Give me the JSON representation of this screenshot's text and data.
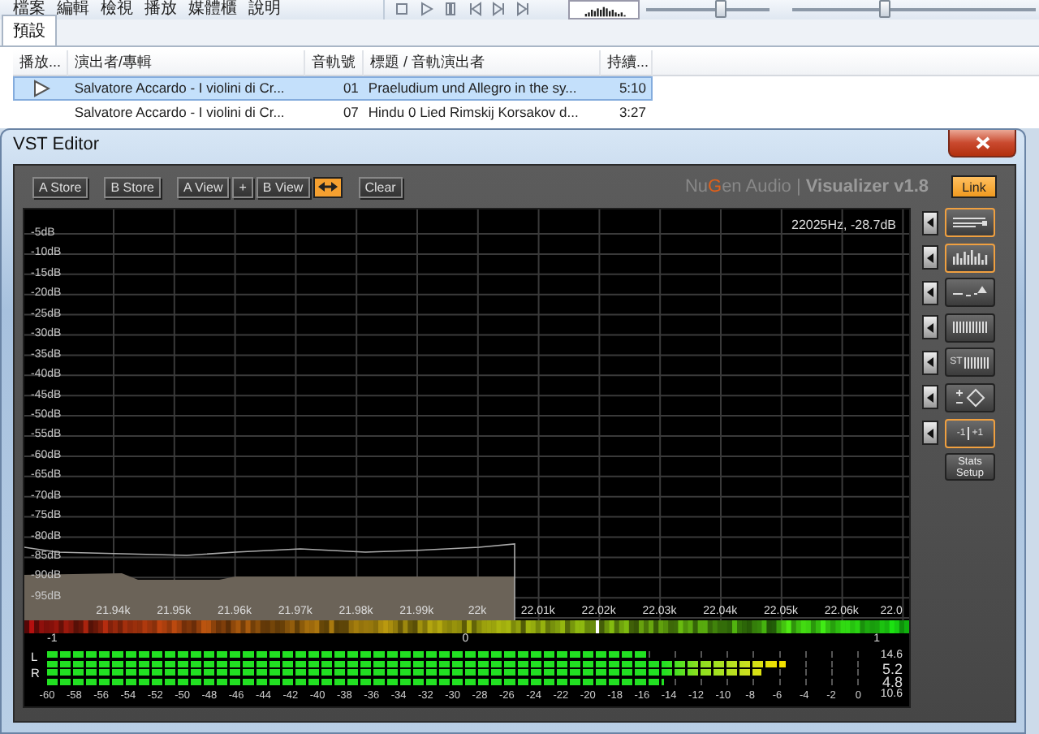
{
  "player": {
    "menu": [
      "檔案",
      "編輯",
      "檢視",
      "播放",
      "媒體櫃",
      "說明"
    ],
    "sliders": [
      {
        "level": 0.6
      },
      {
        "level": 0.38
      }
    ]
  },
  "tabs": [
    {
      "label": "預設",
      "selected": true
    }
  ],
  "playlist": {
    "columns": [
      "播放...",
      "演出者/專輯",
      "音軌號",
      "標題 / 音軌演出者",
      "持續..."
    ],
    "rows": [
      {
        "playing": true,
        "selected": true,
        "artist_album": "Salvatore Accardo - I violini di Cr...",
        "track": "01",
        "title": "Praeludium und Allegro in the sy...",
        "duration": "5:10"
      },
      {
        "playing": false,
        "selected": false,
        "artist_album": "Salvatore Accardo - I violini di Cr...",
        "track": "07",
        "title": "Hindu 0 Lied Rimskij Korsakov d...",
        "duration": "3:27"
      }
    ]
  },
  "editor": {
    "title": "VST Editor",
    "toolbar": [
      {
        "kind": "text",
        "label": "A Store"
      },
      {
        "kind": "gap"
      },
      {
        "kind": "text",
        "label": "B Store"
      },
      {
        "kind": "gap"
      },
      {
        "kind": "text",
        "label": "A View"
      },
      {
        "kind": "text",
        "label": "+"
      },
      {
        "kind": "text",
        "label": "B View"
      },
      {
        "kind": "swap",
        "on": true
      },
      {
        "kind": "gap"
      },
      {
        "kind": "text",
        "label": "Clear"
      }
    ],
    "brand": {
      "maker": [
        "Nu",
        "G",
        "en Audio"
      ],
      "separator": "|",
      "product": "Visualizer v1.8"
    },
    "link": {
      "label": "Link",
      "on": true
    },
    "spectrum": {
      "readout": "22025Hz, -28.7dB",
      "y_labels": [
        "-5dB",
        "-10dB",
        "-15dB",
        "-20dB",
        "-25dB",
        "-30dB",
        "-35dB",
        "-40dB",
        "-45dB",
        "-50dB",
        "-55dB",
        "-60dB",
        "-65dB",
        "-70dB",
        "-75dB",
        "-80dB",
        "-85dB",
        "-90dB",
        "-95dB"
      ],
      "x_labels": [
        "21.94k",
        "21.95k",
        "21.96k",
        "21.97k",
        "21.98k",
        "21.99k",
        "22k",
        "22.01k",
        "22.02k",
        "22.03k",
        "22.04k",
        "22.05k",
        "22.06k",
        "22.0"
      ]
    },
    "correlation": {
      "labels": [
        "-1",
        "0",
        "1"
      ]
    },
    "meters": {
      "channels": [
        "L",
        "R"
      ],
      "bars": [
        {
          "level": 0.74
        },
        {
          "level": 0.91
        },
        {
          "level": 0.88
        },
        {
          "level": 0.76
        }
      ],
      "readouts": [
        "14.6",
        "5.2",
        "4.8",
        "10.6"
      ],
      "scale": [
        "-60",
        "-58",
        "-56",
        "-54",
        "-52",
        "-50",
        "-48",
        "-46",
        "-44",
        "-42",
        "-40",
        "-38",
        "-36",
        "-34",
        "-32",
        "-30",
        "-28",
        "-26",
        "-24",
        "-22",
        "-20",
        "-18",
        "-16",
        "-14",
        "-12",
        "-10",
        "-8",
        "-6",
        "-4",
        "-2",
        "0"
      ]
    },
    "modes": [
      {
        "kind": "lines",
        "selected": true
      },
      {
        "kind": "bars",
        "selected": true
      },
      {
        "kind": "eq",
        "selected": false
      },
      {
        "kind": "comb",
        "selected": false
      },
      {
        "kind": "stereo",
        "selected": false,
        "label": "ST"
      },
      {
        "kind": "diamond",
        "selected": false
      },
      {
        "kind": "phase",
        "selected": true,
        "labels": [
          "-1",
          "+1"
        ]
      }
    ],
    "stats_button": "Stats Setup"
  }
}
